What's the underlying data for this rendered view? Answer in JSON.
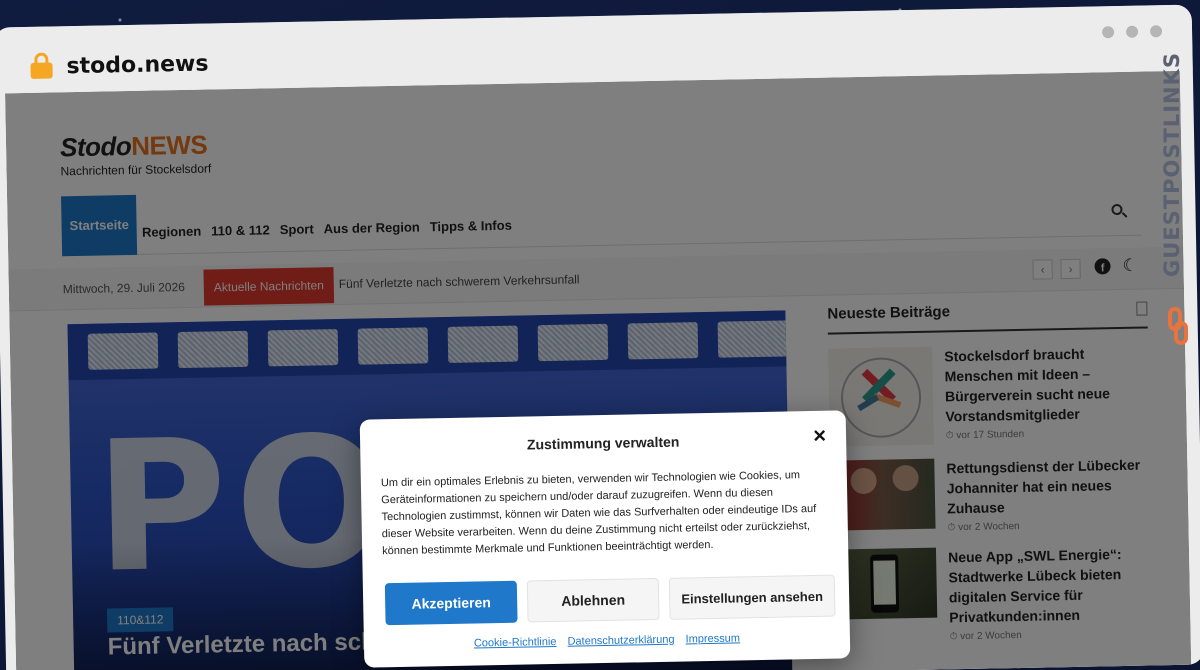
{
  "browser": {
    "url": "stodo.news"
  },
  "site": {
    "logo_main": "Stodo",
    "logo_accent": "NEWS",
    "tagline": "Nachrichten für Stockelsdorf"
  },
  "nav": {
    "items": [
      {
        "label": "Startseite"
      },
      {
        "label": "Regionen"
      },
      {
        "label": "110 & 112"
      },
      {
        "label": "Sport"
      },
      {
        "label": "Aus der Region"
      },
      {
        "label": "Tipps & Infos"
      }
    ]
  },
  "topbar": {
    "date": "Mittwoch, 29. Juli 2026",
    "breaking_label": "Aktuelle Nachrichten",
    "breaking_text": "Fünf Verletzte nach schwerem Verkehrsunfall",
    "prev": "‹",
    "next": "›"
  },
  "hero": {
    "image_text": "POLI",
    "category": "110&112",
    "title": "Fünf Verletzte nach schwerem Verkehrsunfall"
  },
  "sidebar": {
    "heading": "Neueste Beiträge",
    "posts": [
      {
        "title": "Stockelsdorf braucht Menschen mit Ideen – Bürgerverein sucht neue Vorstandsmitglieder",
        "meta": "vor 17 Stunden"
      },
      {
        "title": "Rettungsdienst der Lübecker Johanniter hat ein neues Zuhause",
        "meta": "vor 2 Wochen"
      },
      {
        "title": "Neue App „SWL Energie“: Stadtwerke Lübeck bieten digitalen Service für Privatkunden:innen",
        "meta": "vor 2 Wochen"
      }
    ]
  },
  "consent": {
    "title": "Zustimmung verwalten",
    "close": "×",
    "body": "Um dir ein optimales Erlebnis zu bieten, verwenden wir Technologien wie Cookies, um Geräteinformationen zu speichern und/oder darauf zuzugreifen. Wenn du diesen Technologien zustimmst, können wir Daten wie das Surfverhalten oder eindeutige IDs auf dieser Website verarbeiten. Wenn du deine Zustimmung nicht erteilst oder zurückziehst, können bestimmte Merkmale und Funktionen beeinträchtigt werden.",
    "accept": "Akzeptieren",
    "deny": "Ablehnen",
    "settings": "Einstellungen ansehen",
    "links": [
      "Cookie-Richtlinie",
      "Datenschutzerklärung",
      "Impressum"
    ]
  },
  "watermark": {
    "text": "GUESTPOSTLINKS"
  },
  "colors": {
    "accent": "#1f78c9",
    "breaking": "#e0382f",
    "logo_accent": "#e8731f"
  }
}
